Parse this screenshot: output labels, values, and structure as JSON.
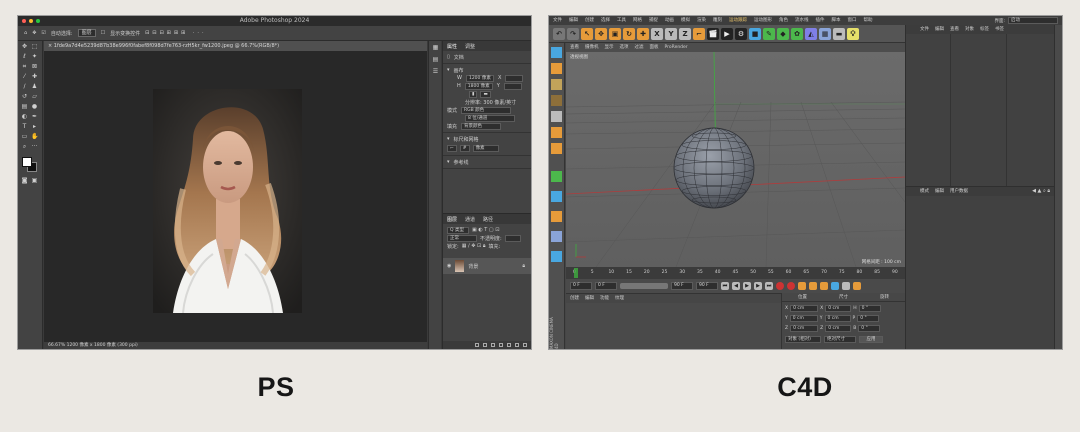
{
  "captions": {
    "left": "PS",
    "right": "C4D"
  },
  "photoshop": {
    "title": "Adobe Photoshop 2024",
    "options_bar": {
      "auto_select_label": "自动选择:",
      "auto_select_value": "图层",
      "transform_label": "显示变换控件"
    },
    "doc_tab": "1fde9a7d4e5239d87b38e996f0fabef8f098d7fe763-rzH5kr_fw1200.jpeg @ 66.7%(RGB/8*)",
    "status": "66.67%   1200 像素 x 1800 像素 (300 ppi)",
    "properties": {
      "tabs": [
        "属性",
        "调整"
      ],
      "doc_label": "文档",
      "canvas_label": "画布",
      "width_label": "W",
      "width_value": "1200 像素",
      "height_label": "H",
      "height_value": "1800 像素",
      "x_label": "X",
      "y_label": "Y",
      "resolution": "分辨率: 300 像素/英寸",
      "mode_label": "模式",
      "mode_value": "RGB 颜色",
      "depth_value": "8 位/通道",
      "fill_label": "填充",
      "fill_value": "背景颜色",
      "guides_label": "标尺和网格",
      "guides_value": "像素",
      "align_label": "参考线"
    },
    "layers": {
      "tabs": [
        "图层",
        "通道",
        "路径"
      ],
      "kind_label": "Q 类型",
      "blend_label": "正常",
      "opacity_label": "不透明度:",
      "fill_label": "填充:",
      "lock_label": "锁定:",
      "layer_name": "背景"
    }
  },
  "cinema4d": {
    "menu": [
      "文件",
      "编辑",
      "创建",
      "选择",
      "工具",
      "网格",
      "捕捉",
      "动画",
      "模拟",
      "渲染",
      "雕刻",
      "运动跟踪",
      "运动图形",
      "角色",
      "流水线",
      "插件",
      "脚本",
      "窗口",
      "帮助"
    ],
    "layout_label": "界面:",
    "layout_value": "启动",
    "viewport_menu": [
      "查看",
      "摄像机",
      "显示",
      "选项",
      "过滤",
      "面板",
      "ProRender"
    ],
    "viewport_name": "透视视图",
    "grid_spacing": "网格间距 : 100 cm",
    "ruler": [
      "0",
      "5",
      "10",
      "15",
      "20",
      "25",
      "30",
      "35",
      "40",
      "45",
      "50",
      "55",
      "60",
      "65",
      "70",
      "75",
      "80",
      "85",
      "90"
    ],
    "frame_current": "0 F",
    "frame_start": "0 F",
    "frame_end": "90 F",
    "frame_end2": "90 F",
    "material_tabs": [
      "创建",
      "编辑",
      "功能",
      "纹理"
    ],
    "object_tabs": [
      "文件",
      "编辑",
      "查看",
      "对象",
      "标签",
      "书签"
    ],
    "attr_tabs": [
      "模式",
      "编辑",
      "用户数据"
    ],
    "coords": {
      "headers": [
        "位置",
        "尺寸",
        "旋转"
      ],
      "rows": [
        {
          "axis": "X",
          "pos": "0 cm",
          "size": "0 cm",
          "rot_axis": "H",
          "rot": "0 °"
        },
        {
          "axis": "Y",
          "pos": "0 cm",
          "size": "0 cm",
          "rot_axis": "P",
          "rot": "0 °"
        },
        {
          "axis": "Z",
          "pos": "0 cm",
          "size": "0 cm",
          "rot_axis": "B",
          "rot": "0 °"
        }
      ],
      "mode_value": "对象 (相对)",
      "size_value": "绝对尺寸",
      "apply_label": "应用"
    },
    "side_label": "MAXON CINEMA 4D"
  }
}
